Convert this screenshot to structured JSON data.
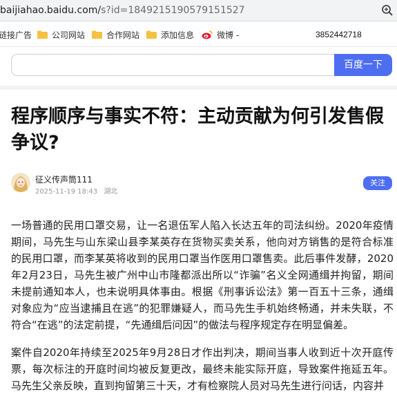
{
  "browser": {
    "url_host": "baijiahao.baidu.com/",
    "url_path": "s?id=1849215190579151527"
  },
  "bookmarks": {
    "items": [
      {
        "label": "链接广告"
      },
      {
        "label": "公司网站"
      },
      {
        "label": "合作网站"
      },
      {
        "label": "添加信息"
      },
      {
        "label": "微博 -"
      }
    ],
    "phone": "3852442718"
  },
  "search": {
    "placeholder": "",
    "button_label": "百度一下"
  },
  "article": {
    "title": "程序顺序与事实不符：主动贡献为何引发售假争议?",
    "author": "征义传声筒111",
    "date": "2025-11-19 18:43",
    "location": "湖北",
    "follow_label": "关注",
    "paragraphs": [
      "一场普通的民用口罩交易，让一名退伍军人陷入长达五年的司法纠纷。2020年疫情期间，马先生与山东梁山县李某英存在货物买卖关系，他向对方销售的是符合标准的民用口罩，而李某英将收到的民用口罩当作医用口罩售卖。此后事件发酵，2020年2月23日，马先生被广州中山市隆都派出所以“诈骗”名义全网通缉并拘留，期间未提前通知本人，也未说明具体事由。根据《刑事诉讼法》第一百五十三条，通缉对象应为“应当逮捕且在逃”的犯罪嫌疑人，而马先生手机始终畅通，并未失联，不符合“在逃”的法定前提，“先通缉后问因”的做法与程序规定存在明显偏差。",
      "案件自2020年持续至2025年9月28日才作出判决，期间当事人收到近十次开庭传票，每次标注的开庭时间均被反复更改，最终未能实际开庭，导致案件拖延五年。马先生父亲反映，直到拘留第三十天，才有检察院人员对马先生进行问话，内容并"
    ]
  },
  "colors": {
    "accent": "#4e6ef2"
  }
}
